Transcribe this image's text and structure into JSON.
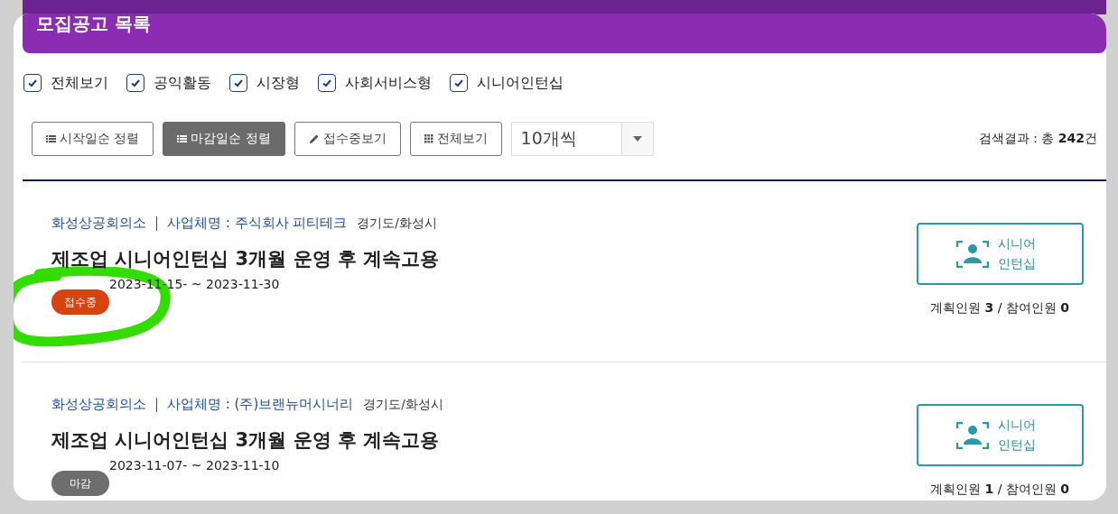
{
  "header": {
    "title": "모집공고 목록"
  },
  "filters": [
    {
      "label": "전체보기",
      "checked": true
    },
    {
      "label": "공익활동",
      "checked": true
    },
    {
      "label": "시장형",
      "checked": true
    },
    {
      "label": "사회서비스형",
      "checked": true
    },
    {
      "label": "시니어인턴십",
      "checked": true
    }
  ],
  "sort_buttons": [
    {
      "label": "시작일순 정렬",
      "kind": "list",
      "selected": false
    },
    {
      "label": "마감일순 정렬",
      "kind": "list",
      "selected": true
    },
    {
      "label": "접수중보기",
      "kind": "pencil",
      "selected": false
    },
    {
      "label": "전체보기",
      "kind": "grid",
      "selected": false
    }
  ],
  "page_size": {
    "value": "10개씩"
  },
  "result": "검색결과 : 총 **242**건",
  "postings": [
    {
      "organization": "화성상공회의소",
      "company": "사업체명 : 주식회사 피티테크",
      "region": "경기도/화성시",
      "title": "제조업 시니어인턴십 3개월 운영 후 계속고용",
      "period": "2023-11-15- ~ 2023-11-30",
      "status": {
        "label": "접수중",
        "kind": "open"
      },
      "type_button": "시니어 인턴십",
      "headcount": "계획인원 **3** / 참여인원 **0**",
      "circled": true
    },
    {
      "organization": "화성상공회의소",
      "company": "사업체명 : (주)브랜뉴머시너리",
      "region": "경기도/화성시",
      "title": "제조업 시니어인턴십 3개월 운영 후 계속고용",
      "period": "2023-11-07- ~ 2023-11-10",
      "status": {
        "label": "마감",
        "kind": "closed"
      },
      "type_button": "시니어 인턴십",
      "headcount": "계획인원 **1** / 참여인원 **0**",
      "circled": false
    }
  ]
}
